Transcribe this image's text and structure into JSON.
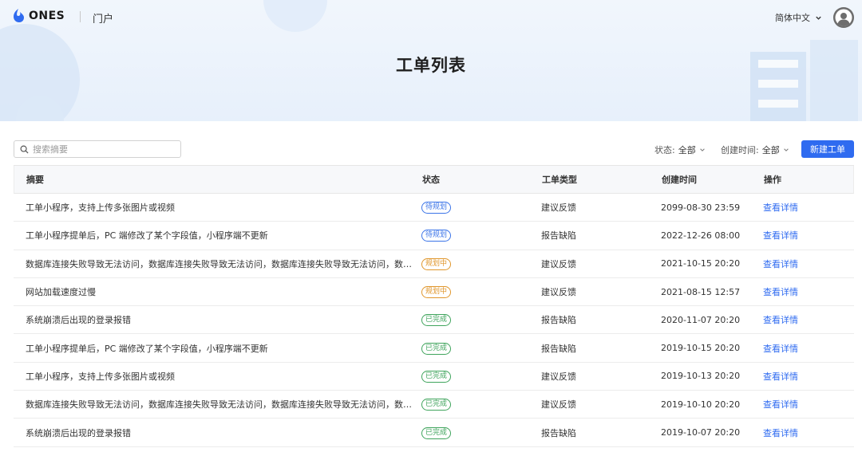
{
  "header": {
    "brand": "ONES",
    "portal": "门户",
    "language": "简体中文"
  },
  "page_title": "工单列表",
  "search": {
    "placeholder": "搜索摘要"
  },
  "filters": {
    "status_label": "状态:",
    "status_value": "全部",
    "created_label": "创建时间:",
    "created_value": "全部"
  },
  "new_button": "新建工单",
  "table": {
    "columns": [
      "摘要",
      "状态",
      "工单类型",
      "创建时间",
      "操作"
    ],
    "rows": [
      {
        "summary": "工单小程序，支持上传多张图片或视频",
        "status": "待规划",
        "type": "建议反馈",
        "created": "2099-08-30 23:59",
        "action": "查看详情"
      },
      {
        "summary": "工单小程序提单后，PC 端修改了某个字段值，小程序端不更新",
        "status": "待规划",
        "type": "报告缺陷",
        "created": "2022-12-26 08:00",
        "action": "查看详情"
      },
      {
        "summary": "数据库连接失败导致无法访问，数据库连接失败导致无法访问，数据库连接失败导致无法访问，数据库...",
        "status": "规划中",
        "type": "建议反馈",
        "created": "2021-10-15 20:20",
        "action": "查看详情"
      },
      {
        "summary": "网站加载速度过慢",
        "status": "规划中",
        "type": "建议反馈",
        "created": "2021-08-15 12:57",
        "action": "查看详情"
      },
      {
        "summary": "系统崩溃后出现的登录报错",
        "status": "已完成",
        "type": "报告缺陷",
        "created": "2020-11-07 20:20",
        "action": "查看详情"
      },
      {
        "summary": "工单小程序提单后，PC 端修改了某个字段值，小程序端不更新",
        "status": "已完成",
        "type": "报告缺陷",
        "created": "2019-10-15 20:20",
        "action": "查看详情"
      },
      {
        "summary": "工单小程序，支持上传多张图片或视频",
        "status": "已完成",
        "type": "建议反馈",
        "created": "2019-10-13 20:20",
        "action": "查看详情"
      },
      {
        "summary": "数据库连接失败导致无法访问，数据库连接失败导致无法访问，数据库连接失败导致无法访问，数据库...",
        "status": "已完成",
        "type": "建议反馈",
        "created": "2019-10-10 20:20",
        "action": "查看详情"
      },
      {
        "summary": "系统崩溃后出现的登录报错",
        "status": "已完成",
        "type": "报告缺陷",
        "created": "2019-10-07 20:20",
        "action": "查看详情"
      }
    ]
  },
  "status_colors": {
    "待规划": "#3b74e8",
    "规划中": "#e0962b",
    "已完成": "#3fa45c"
  },
  "accent_color": "#2f6bf0"
}
